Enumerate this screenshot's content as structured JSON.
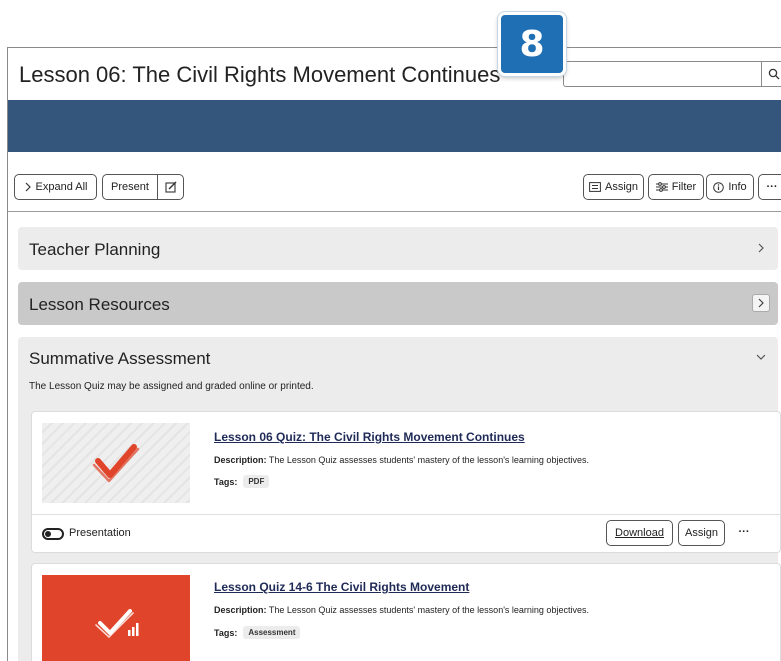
{
  "badge": {
    "number": "8"
  },
  "header": {
    "title": "Lesson 06: The Civil Rights Movement Continues",
    "search_placeholder": ""
  },
  "toolbar": {
    "expand_all": "Expand All",
    "present": "Present",
    "assign": "Assign",
    "filter": "Filter",
    "info": "Info",
    "more": "···"
  },
  "sections": {
    "teacher_planning": "Teacher Planning",
    "lesson_resources": "Lesson Resources",
    "summative": {
      "title": "Summative Assessment",
      "note": "The Lesson Quiz may be assigned and graded online or printed."
    }
  },
  "resources": [
    {
      "title": "Lesson 06 Quiz: The Civil Rights Movement Continues",
      "desc_label": "Description:",
      "desc_text": "The Lesson Quiz assesses students' mastery of the lesson's learning objectives.",
      "tags_label": "Tags:",
      "tag": "PDF",
      "presentation": "Presentation",
      "download": "Download",
      "assign": "Assign",
      "more": "···"
    },
    {
      "title": "Lesson Quiz 14-6 The Civil Rights Movement",
      "desc_label": "Description:",
      "desc_text": "The Lesson Quiz assesses students' mastery of the lesson's learning objectives.",
      "tags_label": "Tags:",
      "tag": "Assessment"
    }
  ],
  "colors": {
    "banner": "#34557c",
    "badge": "#1f6fb5",
    "quiz_red": "#e0442a",
    "link_navy": "#1f2a57"
  }
}
